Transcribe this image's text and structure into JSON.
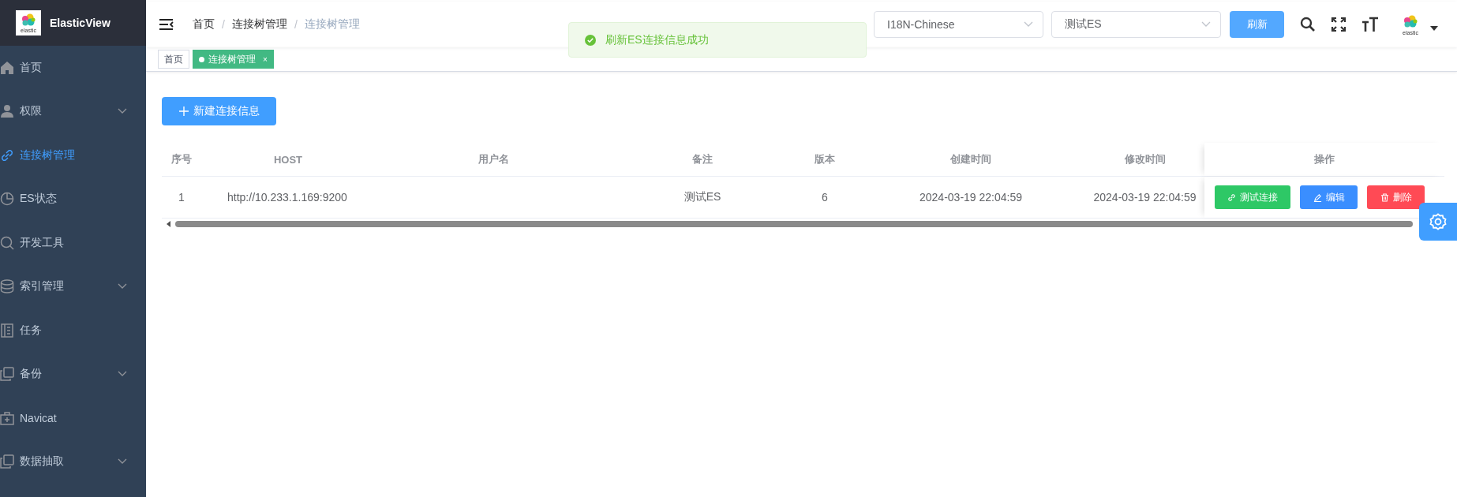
{
  "sidebar": {
    "logo_text": "elastic",
    "title": "ElasticView",
    "items": [
      {
        "label": "首页",
        "expandable": false,
        "selected": false
      },
      {
        "label": "权限",
        "expandable": true,
        "selected": false
      },
      {
        "label": "连接树管理",
        "expandable": false,
        "selected": true
      },
      {
        "label": "ES状态",
        "expandable": false,
        "selected": false
      },
      {
        "label": "开发工具",
        "expandable": false,
        "selected": false
      },
      {
        "label": "索引管理",
        "expandable": true,
        "selected": false
      },
      {
        "label": "任务",
        "expandable": false,
        "selected": false
      },
      {
        "label": "备份",
        "expandable": true,
        "selected": false
      },
      {
        "label": "Navicat",
        "expandable": false,
        "selected": false
      },
      {
        "label": "数据抽取",
        "expandable": true,
        "selected": false
      }
    ]
  },
  "breadcrumb": [
    {
      "label": "首页"
    },
    {
      "separator": "/",
      "label": "连接树管理"
    },
    {
      "separator": "/",
      "label": "连接树管理"
    }
  ],
  "toast": "刷新ES连接信息成功",
  "language_select": {
    "value": "I18N-Chinese"
  },
  "connection_select": {
    "value": "测试ES"
  },
  "refresh_button": "刷新",
  "avatar_text": "elastic",
  "tags": [
    {
      "label": "首页",
      "selected": false
    },
    {
      "label": "连接树管理",
      "selected": true,
      "close": "×"
    }
  ],
  "add_button": "新建连接信息",
  "table": {
    "columns": [
      "序号",
      "HOST",
      "用户名",
      "备注",
      "版本",
      "创建时间",
      "修改时间",
      "操作"
    ],
    "rows": [
      {
        "cells": [
          "1",
          "http://10.233.1.169:9200",
          "",
          "测试ES",
          "6",
          "2024-03-19 22:04:59",
          "2024-03-19 22:04:59"
        ],
        "actions": [
          {
            "kind": "test",
            "label": "测试连接"
          },
          {
            "kind": "edit",
            "label": "编辑"
          },
          {
            "kind": "delete",
            "label": "删除"
          }
        ]
      }
    ]
  }
}
